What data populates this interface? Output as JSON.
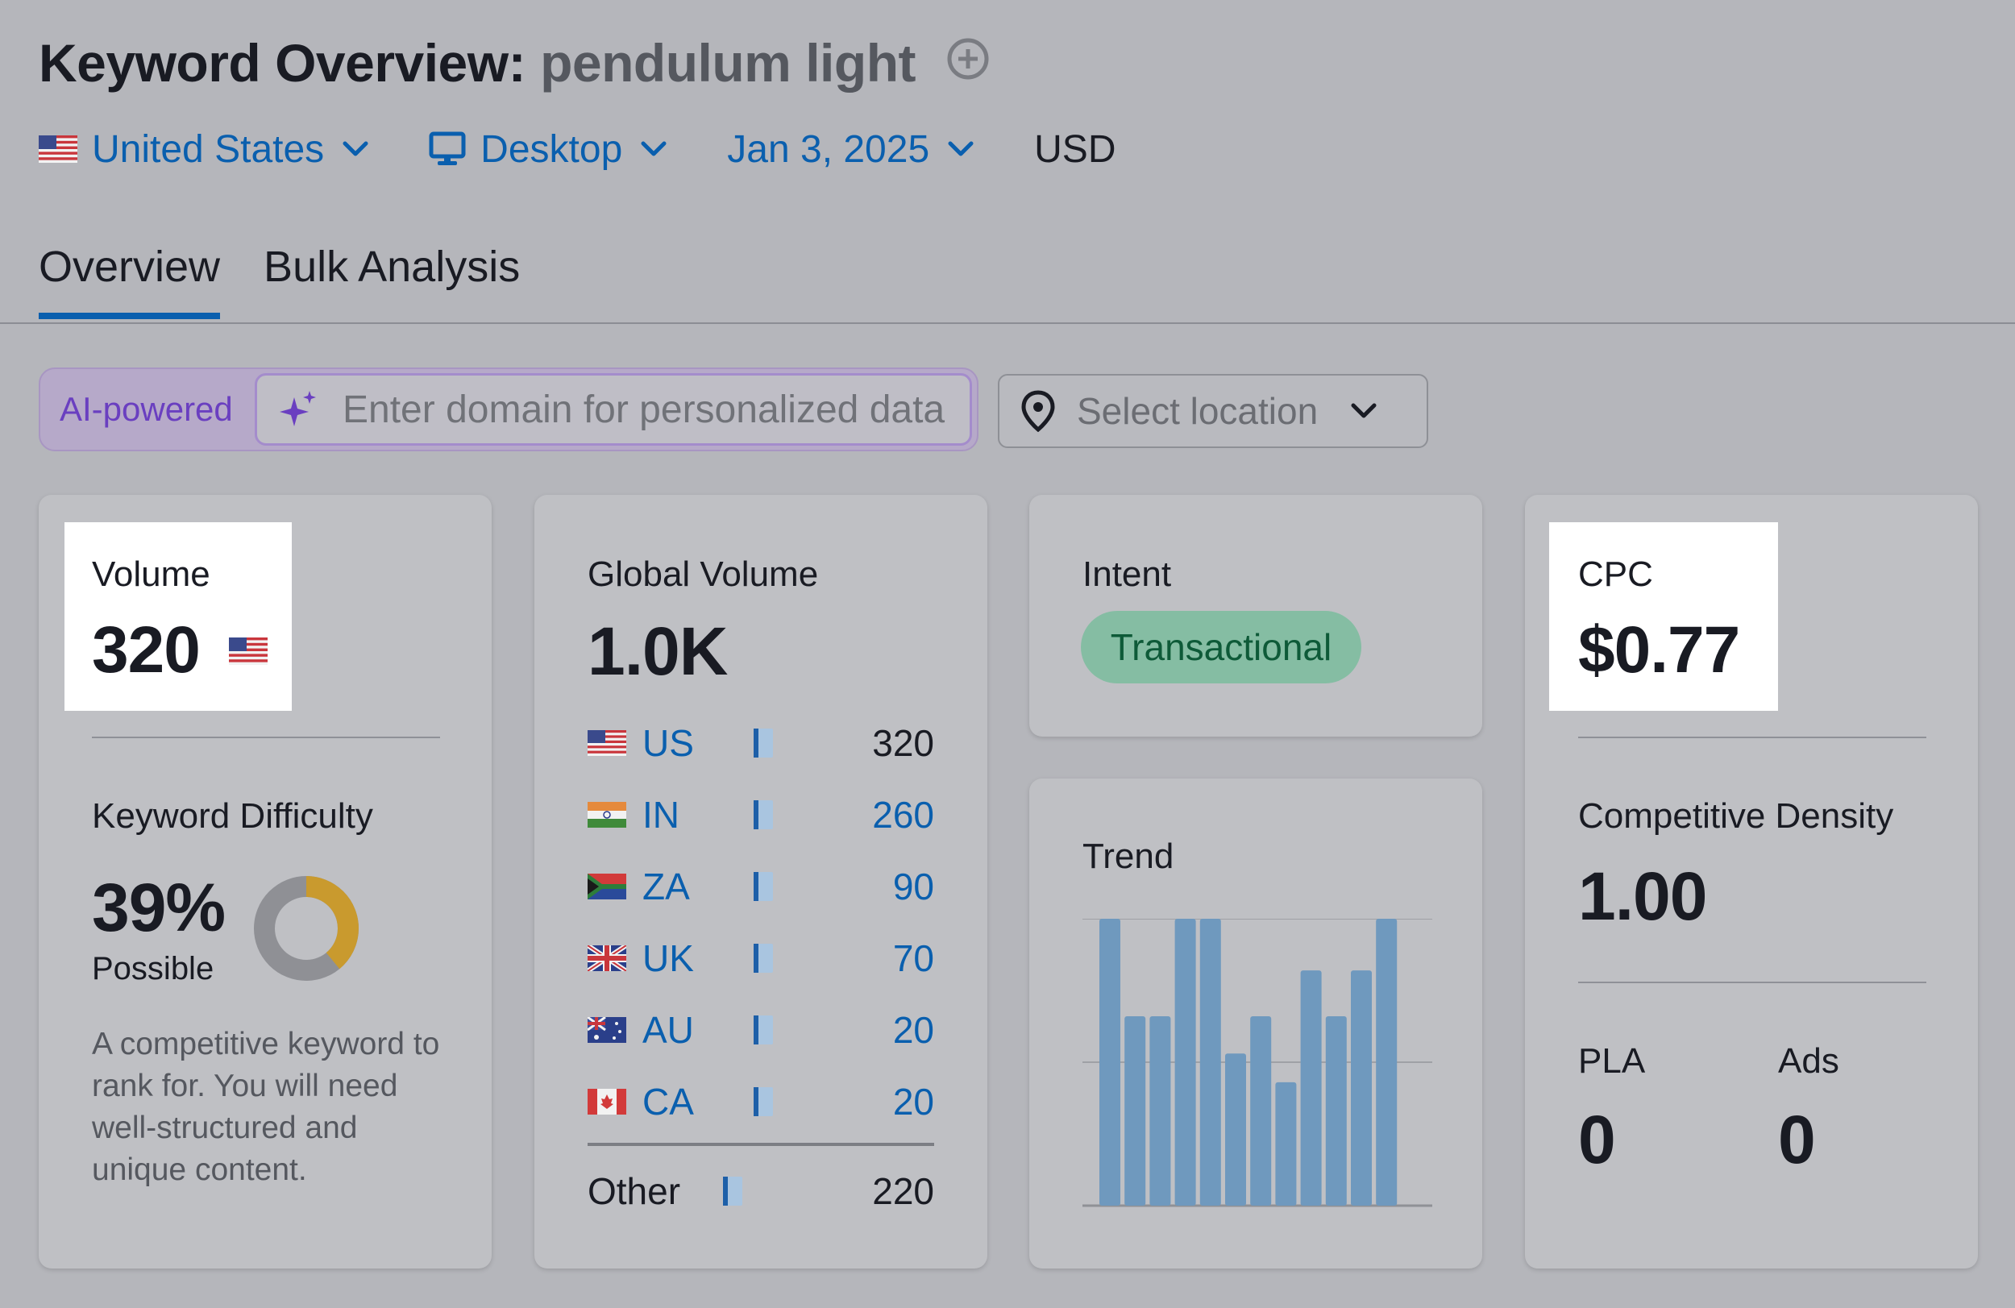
{
  "header": {
    "title": "Keyword Overview:",
    "keyword": "pendulum light",
    "add_icon": "plus-circle-icon"
  },
  "filters": {
    "country": "United States",
    "device": "Desktop",
    "date": "Jan 3, 2025",
    "currency": "USD"
  },
  "tabs": [
    {
      "label": "Overview",
      "active": true
    },
    {
      "label": "Bulk Analysis",
      "active": false
    }
  ],
  "ai_bar": {
    "badge": "AI-powered",
    "placeholder": "Enter domain for personalized data",
    "location_placeholder": "Select location"
  },
  "volume": {
    "label": "Volume",
    "value": "320"
  },
  "keyword_difficulty": {
    "label": "Keyword Difficulty",
    "value": "39%",
    "level": "Possible",
    "percent": 39,
    "description": "A competitive keyword to rank for. You will need well-structured and unique content."
  },
  "global_volume": {
    "label": "Global Volume",
    "value": "1.0K",
    "rows": [
      {
        "code": "US",
        "value": "320",
        "flag": "us"
      },
      {
        "code": "IN",
        "value": "260",
        "flag": "in"
      },
      {
        "code": "ZA",
        "value": "90",
        "flag": "za"
      },
      {
        "code": "UK",
        "value": "70",
        "flag": "uk"
      },
      {
        "code": "AU",
        "value": "20",
        "flag": "au"
      },
      {
        "code": "CA",
        "value": "20",
        "flag": "ca"
      }
    ],
    "other": {
      "label": "Other",
      "value": "220"
    }
  },
  "intent": {
    "label": "Intent",
    "badge": "Transactional"
  },
  "trend": {
    "label": "Trend",
    "values": [
      100,
      66,
      66,
      100,
      100,
      53,
      66,
      43,
      82,
      66,
      82,
      100
    ]
  },
  "cpc": {
    "label": "CPC",
    "value": "$0.77"
  },
  "competitive_density": {
    "label": "Competitive Density",
    "value": "1.00"
  },
  "pla": {
    "label": "PLA",
    "value": "0"
  },
  "ads": {
    "label": "Ads",
    "value": "0"
  },
  "colors": {
    "accent": "#0a5fae",
    "ai_purple": "#6a3fc0",
    "kd_gold": "#c99a2e",
    "trend_bar": "#6f99be",
    "intent_green": "#85bda3"
  }
}
